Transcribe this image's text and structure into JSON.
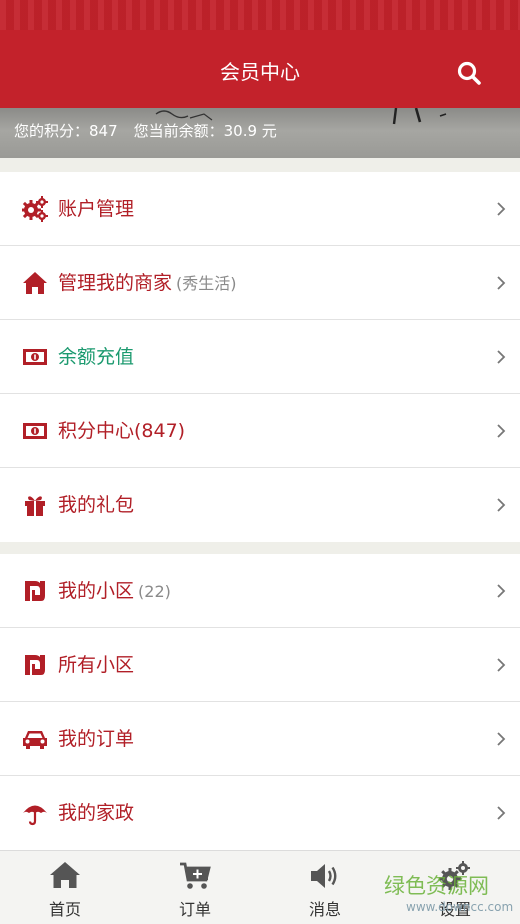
{
  "header": {
    "title": "会员中心",
    "search_icon": "search-icon"
  },
  "banner": {
    "points_text": "您的积分：847",
    "balance_text": "您当前余额：30.9 元"
  },
  "menu_group_1": [
    {
      "label": "账户管理",
      "sub": "",
      "icon": "gears-icon",
      "label_color": "#b11f27"
    },
    {
      "label": "管理我的商家",
      "sub": "(秀生活)",
      "icon": "home-icon",
      "label_color": "#b11f27"
    },
    {
      "label": "余额充值",
      "sub": "",
      "icon": "money-icon",
      "label_color": "#1c9a6f"
    },
    {
      "label": "积分中心(847)",
      "sub": "",
      "icon": "money-icon",
      "label_color": "#b11f27"
    },
    {
      "label": "我的礼包",
      "sub": "",
      "icon": "gift-icon",
      "label_color": "#b11f27"
    }
  ],
  "menu_group_2": [
    {
      "label": "我的小区",
      "sub": "(22)",
      "icon": "community-icon",
      "label_color": "#b11f27"
    },
    {
      "label": "所有小区",
      "sub": "",
      "icon": "community-icon",
      "label_color": "#b11f27"
    },
    {
      "label": "我的订单",
      "sub": "",
      "icon": "car-icon",
      "label_color": "#b11f27"
    },
    {
      "label": "我的家政",
      "sub": "",
      "icon": "umbrella-icon",
      "label_color": "#b11f27"
    }
  ],
  "tabs": [
    {
      "label": "首页",
      "icon": "home-icon"
    },
    {
      "label": "订单",
      "icon": "cart-add-icon"
    },
    {
      "label": "消息",
      "icon": "speaker-icon"
    },
    {
      "label": "设置",
      "icon": "gears-icon"
    }
  ],
  "watermark": {
    "line1": "绿色资源网",
    "line2": "www.downcc.com"
  },
  "colors": {
    "brand_red": "#c3222b",
    "icon_red": "#b11f27",
    "accent_green": "#1c9a6f"
  }
}
